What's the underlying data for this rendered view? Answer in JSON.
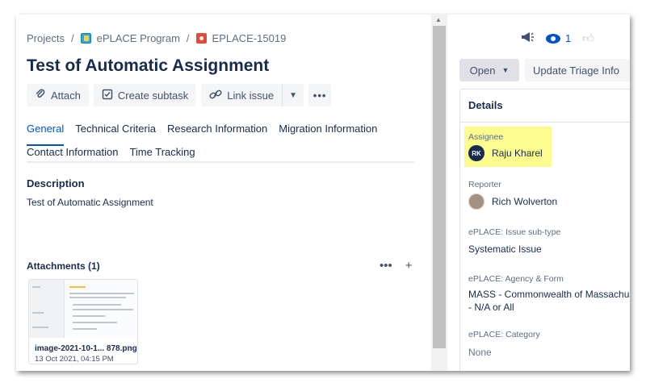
{
  "breadcrumb": {
    "projects": "Projects",
    "sep": "/",
    "program": "ePLACE Program",
    "issue_key": "EPLACE-15019"
  },
  "issue": {
    "title": "Test of Automatic Assignment"
  },
  "toolbar": {
    "attach": "Attach",
    "create_subtask": "Create subtask",
    "link_issue": "Link issue",
    "more": "•••"
  },
  "tabs": {
    "row1": [
      "General",
      "Technical Criteria",
      "Research Information",
      "Migration Information"
    ],
    "row2": [
      "Contact Information",
      "Time Tracking"
    ],
    "active": "General"
  },
  "description": {
    "heading": "Description",
    "text": "Test of Automatic Assignment"
  },
  "attachments": {
    "heading": "Attachments (1)",
    "more": "•••",
    "add": "+",
    "items": [
      {
        "name": "image-2021-10-1... 878.png",
        "date": "13 Oct 2021, 04:15 PM"
      }
    ]
  },
  "header_actions": {
    "watch_count": "1"
  },
  "status": {
    "current": "Open",
    "triage_button": "Update Triage Info"
  },
  "details": {
    "heading": "Details",
    "assignee": {
      "label": "Assignee",
      "name": "Raju Kharel",
      "initials": "RK"
    },
    "reporter": {
      "label": "Reporter",
      "name": "Rich Wolverton"
    },
    "subtype": {
      "label": "ePLACE: Issue sub-type",
      "value": "Systematic Issue"
    },
    "agency": {
      "label": "ePLACE: Agency & Form",
      "value_line1": "MASS - Commonwealth of Massachus",
      "value_line2": "- N/A or All"
    },
    "category": {
      "label": "ePLACE: Category",
      "value": "None"
    }
  },
  "colors": {
    "link_blue": "#0052cc",
    "highlight": "#fcfc8e",
    "button_bg": "#f4f5f7"
  }
}
